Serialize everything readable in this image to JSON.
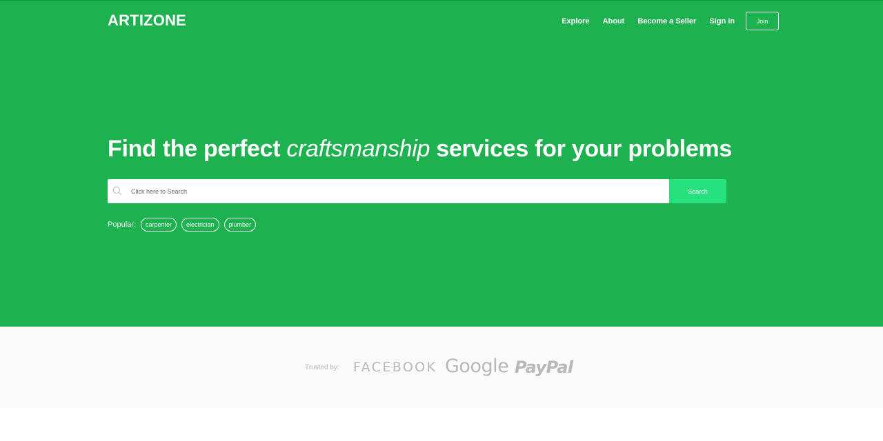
{
  "brand": {
    "logo": "ARTIZONE"
  },
  "nav": {
    "items": [
      "Explore",
      "About",
      "Become a Seller",
      "Sign in"
    ],
    "join_label": "Join"
  },
  "hero": {
    "headline_prefix": "Find the perfect ",
    "headline_emphasis": "craftsmanship",
    "headline_suffix": " services for your problems",
    "background_color": "#1db14f"
  },
  "search": {
    "placeholder": "Click here to Search",
    "value": "",
    "button_label": "Search",
    "button_color": "#27e17f",
    "icon": "search-icon"
  },
  "popular": {
    "label": "Popular:",
    "tags": [
      "carpenter",
      "electrician",
      "plumber"
    ]
  },
  "trusted": {
    "label": "Trusted by:",
    "brands": [
      "FACEBOOK",
      "Google",
      "PayPal"
    ]
  }
}
